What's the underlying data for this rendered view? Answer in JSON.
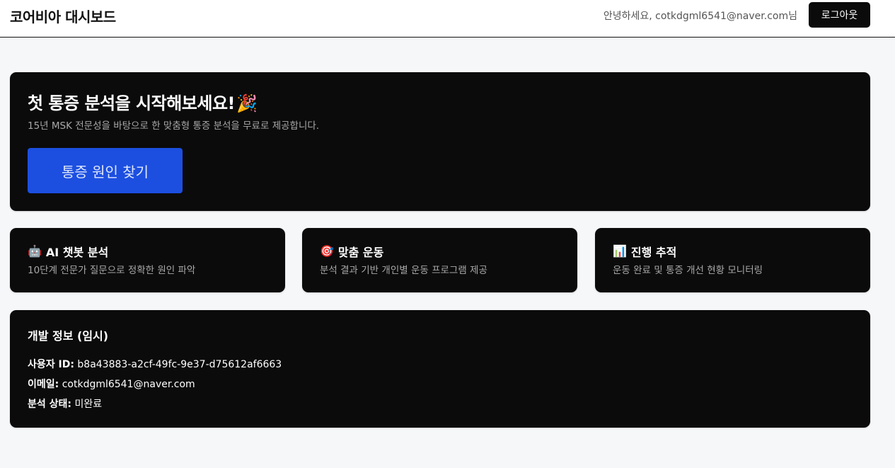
{
  "header": {
    "title": "코어비아 대시보드",
    "greeting": "안녕하세요, cotkdgml6541@naver.com님",
    "logout_label": "로그아웃"
  },
  "hero": {
    "title": "첫 통증 분석을 시작해보세요!",
    "title_icon": "🎉",
    "subtitle": "15년 MSK 전문성을 바탕으로 한 맞춤형 통증 분석을 무료로 제공합니다.",
    "cta_label": "통증 원인 찾기",
    "cta_color": "#1c4fe0"
  },
  "features": [
    {
      "icon": "🤖",
      "title": "AI 챗봇 분석",
      "desc": "10단계 전문가 질문으로 정확한 원인 파악"
    },
    {
      "icon": "🎯",
      "title": "맞춤 운동",
      "desc": "분석 결과 기반 개인별 운동 프로그램 제공"
    },
    {
      "icon": "📊",
      "title": "진행 추적",
      "desc": "운동 완료 및 통증 개선 현황 모니터링"
    }
  ],
  "dev_info": {
    "title": "개발 정보 (임시)",
    "user_id_label": "사용자 ID:",
    "user_id": "b8a43883-a2cf-49fc-9e37-d75612af6663",
    "email_label": "이메일:",
    "email": "cotkdgml6541@naver.com",
    "status_label": "분석 상태:",
    "status": "미완료"
  }
}
